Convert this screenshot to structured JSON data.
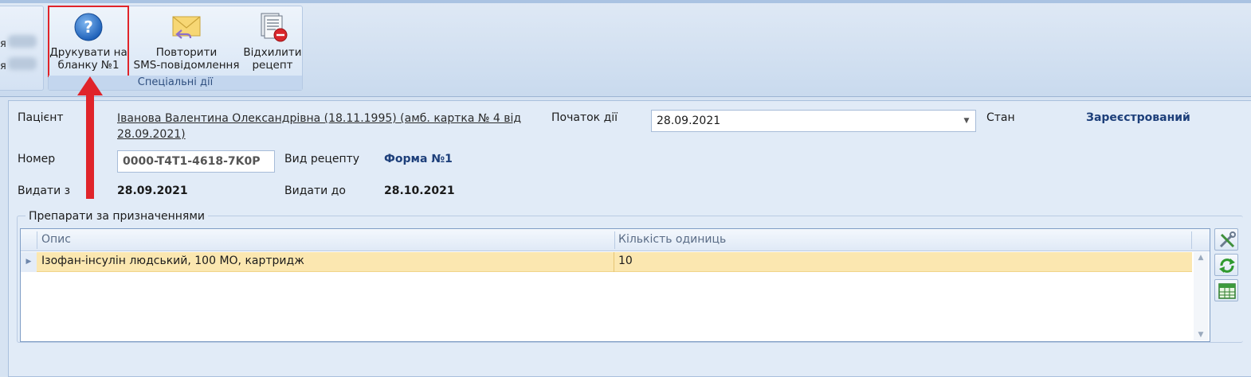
{
  "ribbon": {
    "prev_group_fragments": [
      "я",
      "я"
    ],
    "group_caption": "Спеціальні дії",
    "buttons": [
      {
        "label_line1": "Друкувати на",
        "label_line2": "бланку №1",
        "icon": "help-print-icon"
      },
      {
        "label_line1": "Повторити",
        "label_line2": "SMS-повідомлення",
        "icon": "envelope-reply-icon"
      },
      {
        "label_line1": "Відхилити",
        "label_line2": "рецепт",
        "icon": "reject-prescription-icon"
      }
    ]
  },
  "form": {
    "patient_label": "Пацієнт",
    "patient_line1": "Іванова Валентина Олександрівна (18.11.1995) (амб. картка № 4 від",
    "patient_line2": "28.09.2021)",
    "start_label": "Початок дії",
    "start_value": "28.09.2021",
    "state_label": "Стан",
    "state_value": "Зареєстрований",
    "number_label": "Номер",
    "number_value": "0000-T4T1-4618-7K0P",
    "recipe_type_label": "Вид рецепту",
    "recipe_type_value": "Форма №1",
    "issue_from_label": "Видати з",
    "issue_from_value": "28.09.2021",
    "issue_to_label": "Видати до",
    "issue_to_value": "28.10.2021"
  },
  "drugs": {
    "group_title": "Препарати за призначеннями",
    "columns": [
      "Опис",
      "Кількість одиниць"
    ],
    "rows": [
      {
        "description": "Ізофан-інсулін людський, 100 МО, картридж",
        "quantity": "10"
      }
    ]
  },
  "colors": {
    "highlight_frame": "#e0242a",
    "arrow": "#e0242a",
    "selected_row": "#fbe7b0",
    "value_blue": "#1d3f7a"
  }
}
